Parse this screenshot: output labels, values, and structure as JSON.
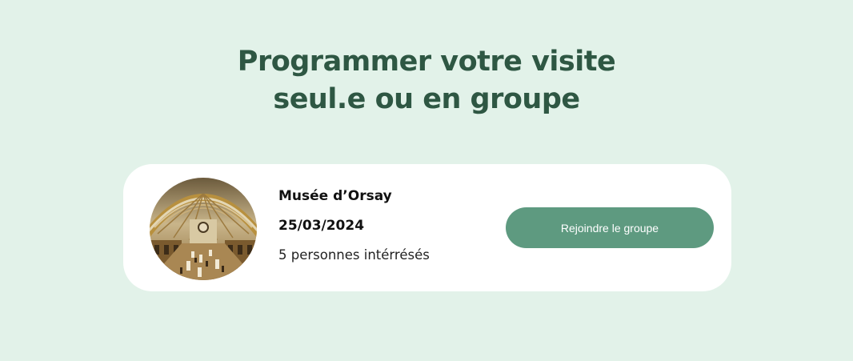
{
  "heading": {
    "line1": "Programmer votre visite",
    "line2": "seul.e ou en groupe"
  },
  "visit": {
    "museum": "Musée d’Orsay",
    "date": "25/03/2024",
    "interested": "5 personnes intérrésés",
    "image_alt": "Musée d’Orsay interior",
    "join_label": "Rejoindre le groupe"
  },
  "colors": {
    "background": "#e2f2e9",
    "heading": "#2e5743",
    "button": "#5e9a80",
    "card": "#ffffff"
  }
}
